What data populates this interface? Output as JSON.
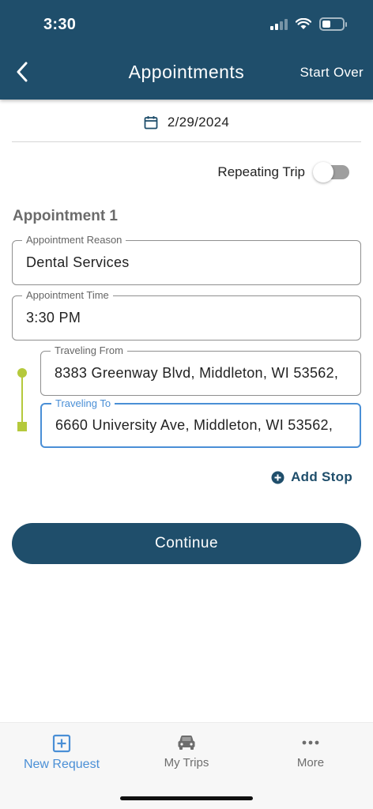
{
  "status_bar": {
    "time": "3:30"
  },
  "header": {
    "title": "Appointments",
    "start_over_label": "Start Over"
  },
  "date": {
    "value": "2/29/2024"
  },
  "repeating_trip": {
    "label": "Repeating Trip",
    "enabled": false
  },
  "appointment": {
    "title": "Appointment 1",
    "reason": {
      "label": "Appointment Reason",
      "value": "Dental Services"
    },
    "time": {
      "label": "Appointment Time",
      "value": "3:30 PM"
    },
    "from": {
      "label": "Traveling From",
      "value": "8383 Greenway Blvd, Middleton, WI 53562,"
    },
    "to": {
      "label": "Traveling To",
      "value": "6660 University Ave, Middleton, WI 53562,"
    }
  },
  "add_stop_label": "Add Stop",
  "continue_label": "Continue",
  "tabs": [
    {
      "label": "New Request",
      "icon": "plus-square-icon",
      "active": true
    },
    {
      "label": "My Trips",
      "icon": "car-icon",
      "active": false
    },
    {
      "label": "More",
      "icon": "more-dots-icon",
      "active": false
    }
  ],
  "colors": {
    "header": "#1f4e6b",
    "accent": "#4a8fd6",
    "route": "#b5c93c"
  }
}
